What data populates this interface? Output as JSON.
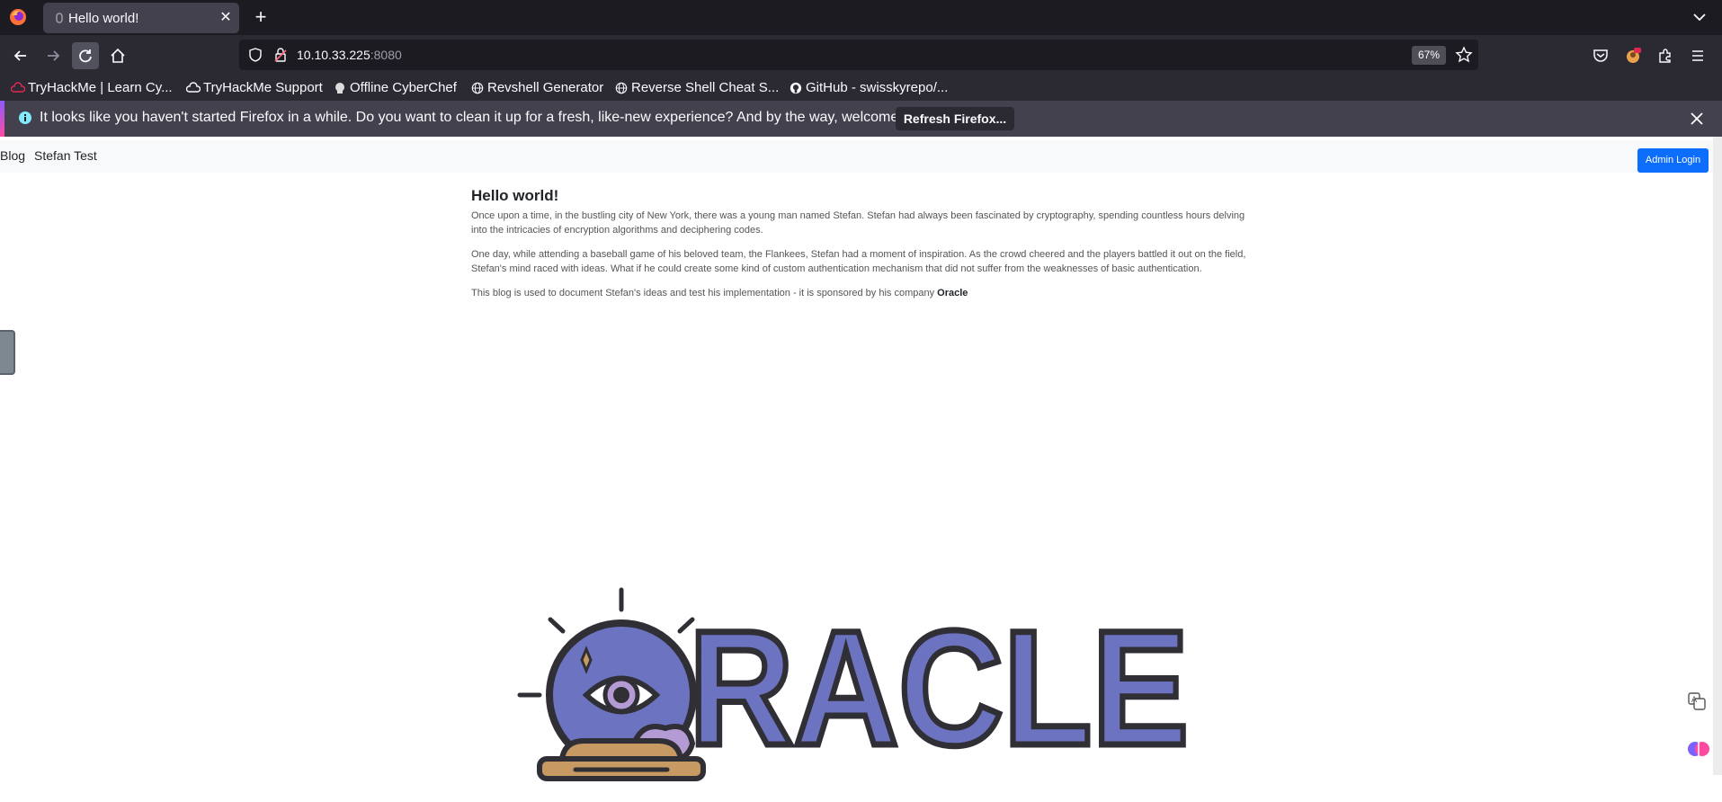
{
  "browser": {
    "tab": {
      "title": "Hello world!",
      "close_glyph": "✕"
    },
    "new_tab_glyph": "+",
    "url": {
      "host": "10.10.33.225",
      "port": ":8080"
    },
    "zoom": "67%",
    "bookmarks": [
      {
        "label": "TryHackMe | Learn Cy...",
        "icon": "tryhackme-icon"
      },
      {
        "label": "TryHackMe Support",
        "icon": "cloud-icon"
      },
      {
        "label": "Offline CyberChef",
        "icon": "chef-icon"
      },
      {
        "label": "Revshell Generator",
        "icon": "globe-icon"
      },
      {
        "label": "Reverse Shell Cheat S...",
        "icon": "globe-icon"
      },
      {
        "label": "GitHub - swisskyrepo/...",
        "icon": "github-icon"
      }
    ],
    "notification": {
      "message": "It looks like you haven't started Firefox in a while. Do you want to clean it up for a fresh, like-new experience? And by the way, welcome back!",
      "button_label": "Refresh Firefox..."
    }
  },
  "page": {
    "nav": {
      "blog": "Blog",
      "stefan_test": "Stefan Test",
      "admin_login": "Admin Login"
    },
    "post": {
      "title": "Hello world!",
      "p1": "Once upon a time, in the bustling city of New York, there was a young man named Stefan. Stefan had always been fascinated by cryptography, spending countless hours delving into the intricacies of encryption algorithms and deciphering codes.",
      "p2": "One day, while attending a baseball game of his beloved team, the Flankees, Stefan had a moment of inspiration. As the crowd cheered and the players battled it out on the field, Stefan's mind raced with ideas. What if he could create some kind of custom authentication mechanism that did not suffer from the weaknesses of basic authentication.",
      "p3_prefix": "This blog is used to document Stefan's ideas and test his implementation - it is sponsored by his company ",
      "p3_company": "Oracle"
    },
    "logo_text": "RACLE"
  },
  "colors": {
    "browser_dark": "#1c1b22",
    "toolbar": "#2b2a33",
    "primary_button": "#0d6efd",
    "logo_fill": "#6c73c0",
    "logo_stroke": "#2f2f35",
    "logo_base": "#c69a62",
    "logo_cloud": "#b49bd4"
  }
}
